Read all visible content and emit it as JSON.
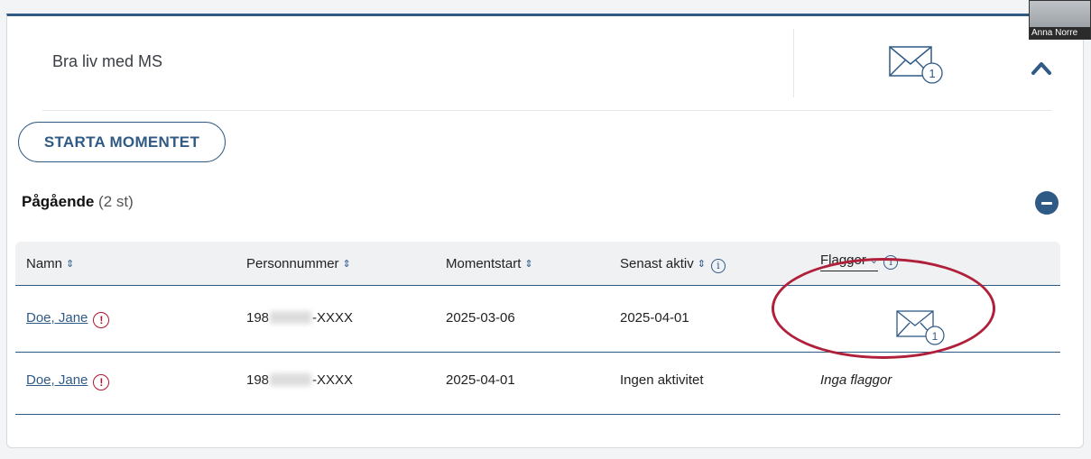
{
  "module": {
    "title": "Bra liv med MS",
    "message_count": "1"
  },
  "start_button": {
    "label": "STARTA MOMENTET"
  },
  "section": {
    "label": "Pågående",
    "count": "(2 st)"
  },
  "table": {
    "columns": {
      "name": "Namn",
      "personnummer": "Personnummer",
      "momentstart": "Momentstart",
      "senast_aktiv": "Senast aktiv",
      "flaggor": "Flaggor"
    },
    "rows": [
      {
        "name": "Doe, Jane",
        "pn_prefix": "198",
        "pn_suffix": "-XXXX",
        "momentstart": "2025-03-06",
        "senast_aktiv": "2025-04-01",
        "flag_count": "1"
      },
      {
        "name": "Doe, Jane",
        "pn_prefix": "198",
        "pn_suffix": "-XXXX",
        "momentstart": "2025-04-01",
        "senast_aktiv": "Ingen aktivitet",
        "flaggor": "Inga flaggor"
      }
    ]
  },
  "video_tile": {
    "name": "Anna Norre"
  },
  "icons": {
    "envelope": "envelope-icon",
    "chevron": "chevron-up-icon",
    "collapse": "minus-circle-icon",
    "sort": "sort-icon",
    "info": "info-icon",
    "warning": "warning-icon"
  },
  "colors": {
    "accent": "#2f5a86",
    "warning": "#b4152a",
    "highlight_ellipse": "#b0203a"
  }
}
